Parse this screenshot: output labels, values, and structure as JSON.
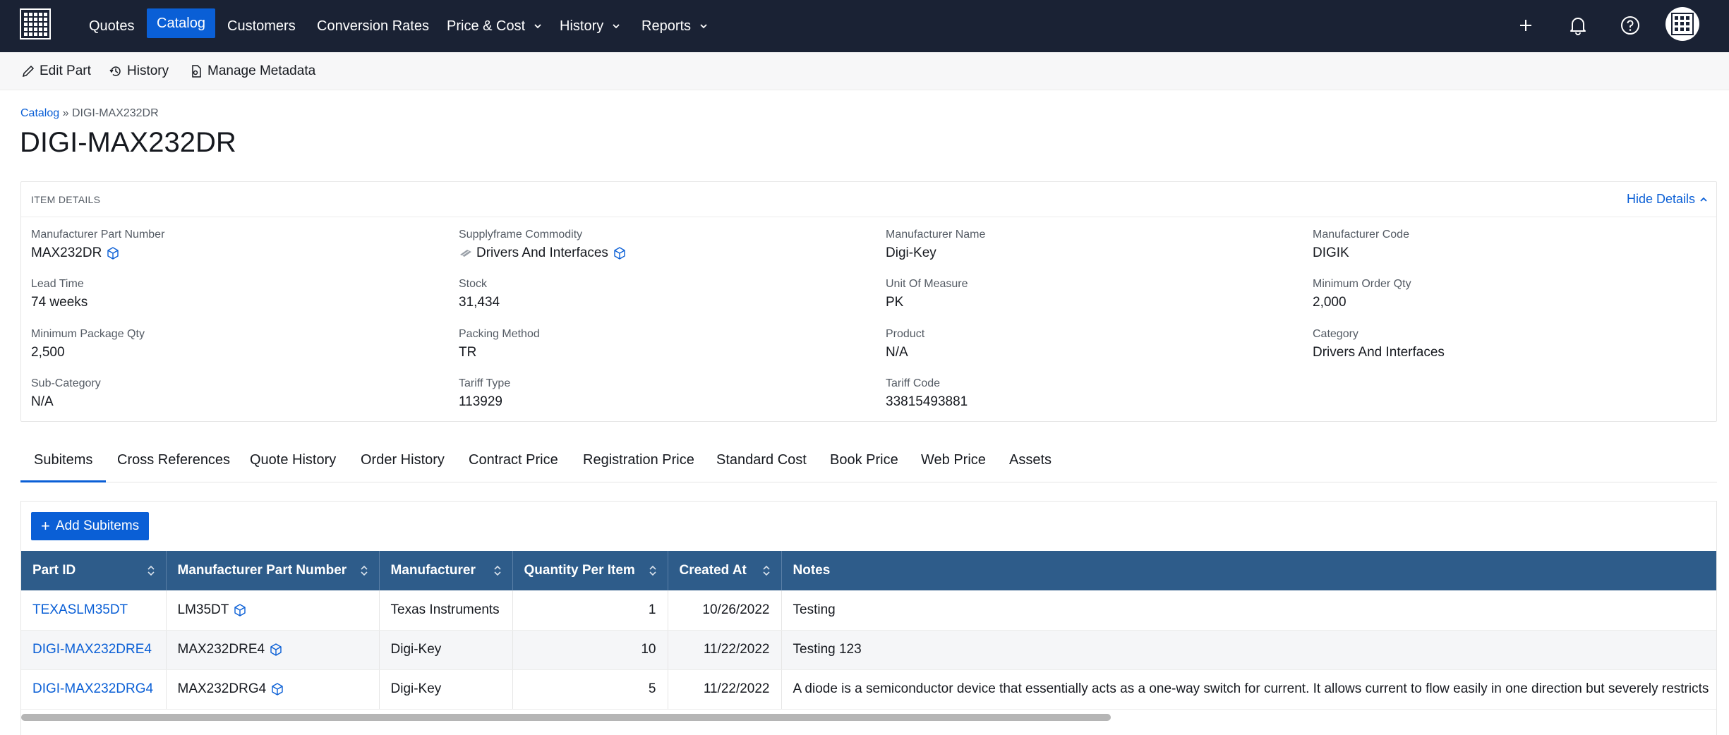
{
  "nav": {
    "items": [
      {
        "label": "Quotes"
      },
      {
        "label": "Catalog"
      },
      {
        "label": "Customers"
      },
      {
        "label": "Conversion Rates"
      },
      {
        "label": "Price & Cost"
      },
      {
        "label": "History"
      },
      {
        "label": "Reports"
      }
    ],
    "active": "Catalog",
    "right_icons": [
      "plus-icon",
      "bell-icon",
      "help-icon",
      "grid-avatar-icon"
    ]
  },
  "toolbar": {
    "edit_label": "Edit Part",
    "history_label": "History",
    "metadata_label": "Manage Metadata"
  },
  "breadcrumb": {
    "root": "Catalog",
    "sep": "»",
    "current": "DIGI-MAX232DR"
  },
  "page": {
    "title": "DIGI-MAX232DR"
  },
  "details": {
    "title": "ITEM DETAILS",
    "hide_label": "Hide Details",
    "fields": {
      "mpn": {
        "label": "Manufacturer Part Number",
        "value": "MAX232DR"
      },
      "commodity": {
        "label": "Supplyframe Commodity",
        "value": "Drivers And Interfaces"
      },
      "mfr_name": {
        "label": "Manufacturer Name",
        "value": "Digi-Key"
      },
      "mfr_code": {
        "label": "Manufacturer Code",
        "value": "DIGIK"
      },
      "lead_time": {
        "label": "Lead Time",
        "value": "74 weeks"
      },
      "stock": {
        "label": "Stock",
        "value": "31,434"
      },
      "uom": {
        "label": "Unit Of Measure",
        "value": "PK"
      },
      "moq": {
        "label": "Minimum Order Qty",
        "value": "2,000"
      },
      "mpq": {
        "label": "Minimum Package Qty",
        "value": "2,500"
      },
      "packing": {
        "label": "Packing Method",
        "value": "TR"
      },
      "product": {
        "label": "Product",
        "value": "N/A"
      },
      "category": {
        "label": "Category",
        "value": "Drivers And Interfaces"
      },
      "subcategory": {
        "label": "Sub-Category",
        "value": "N/A"
      },
      "tariff_type": {
        "label": "Tariff Type",
        "value": "113929"
      },
      "tariff_code": {
        "label": "Tariff Code",
        "value": "33815493881"
      }
    }
  },
  "tabs": [
    {
      "label": "Subitems"
    },
    {
      "label": "Cross References"
    },
    {
      "label": "Quote History"
    },
    {
      "label": "Order History"
    },
    {
      "label": "Contract Price"
    },
    {
      "label": "Registration Price"
    },
    {
      "label": "Standard Cost"
    },
    {
      "label": "Book Price"
    },
    {
      "label": "Web Price"
    },
    {
      "label": "Assets"
    }
  ],
  "active_tab": "Subitems",
  "subitems": {
    "add_label": "Add Subitems",
    "columns": [
      "Part ID",
      "Manufacturer Part Number",
      "Manufacturer",
      "Quantity Per Item",
      "Created At",
      "Notes"
    ],
    "rows": [
      {
        "part_id": "TEXASLM35DT",
        "mpn": "LM35DT",
        "manufacturer": "Texas Instruments",
        "qty": "1",
        "created": "10/26/2022",
        "notes": "Testing"
      },
      {
        "part_id": "DIGI-MAX232DRE4",
        "mpn": "MAX232DRE4",
        "manufacturer": "Digi-Key",
        "qty": "10",
        "created": "11/22/2022",
        "notes": "Testing 123"
      },
      {
        "part_id": "DIGI-MAX232DRG4",
        "mpn": "MAX232DRG4",
        "manufacturer": "Digi-Key",
        "qty": "5",
        "created": "11/22/2022",
        "notes": "A diode is a semiconductor device that essentially acts as a one-way switch for current. It allows current to flow easily in one direction but severely restricts"
      }
    ]
  },
  "colors": {
    "nav_bg": "#1a2234",
    "accent": "#0a5fd6",
    "table_header": "#2e5c8a"
  }
}
